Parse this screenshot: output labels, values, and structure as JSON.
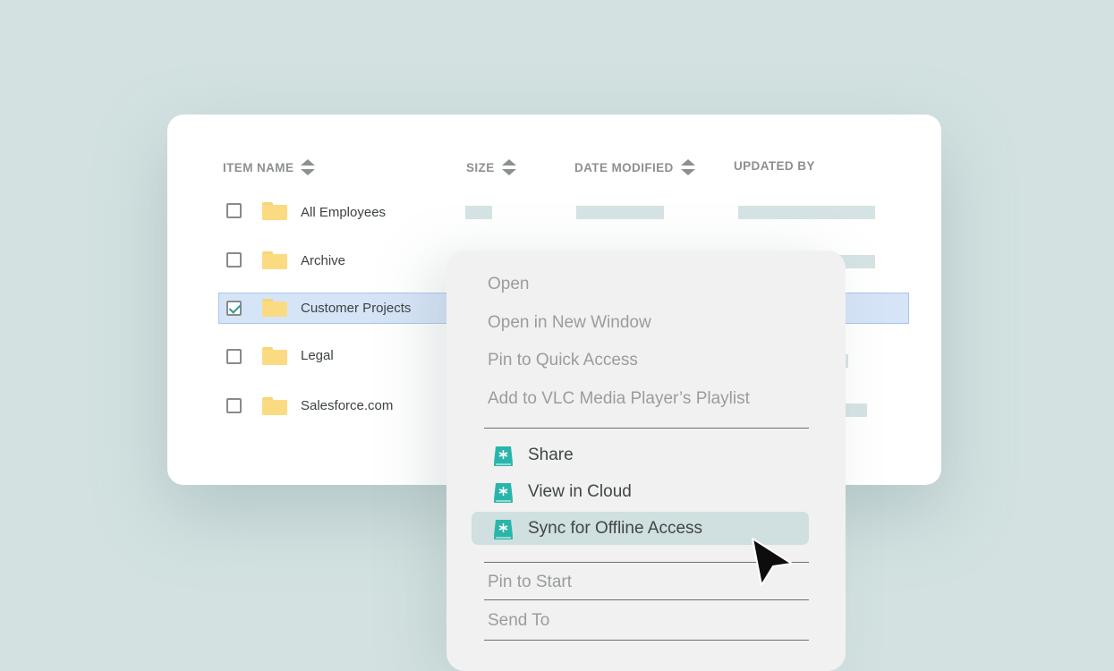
{
  "table": {
    "columns": [
      {
        "label": "ITEM NAME",
        "sortable": true
      },
      {
        "label": "SIZE",
        "sortable": true
      },
      {
        "label": "DATE MODIFIED",
        "sortable": true
      },
      {
        "label": "UPDATED BY",
        "sortable": false
      }
    ],
    "rows": [
      {
        "name": "All Employees",
        "checked": false
      },
      {
        "name": "Archive",
        "checked": false
      },
      {
        "name": "Customer Projects",
        "checked": true
      },
      {
        "name": "Legal",
        "checked": false
      },
      {
        "name": "Salesforce.com",
        "checked": false
      }
    ]
  },
  "context_menu": {
    "items": [
      {
        "label": "Open"
      },
      {
        "label": "Open in New Window"
      },
      {
        "label": "Pin to Quick Access"
      },
      {
        "label": "Add to VLC Media Player’s Playlist"
      },
      {
        "label": "Share",
        "icon": "cloud-sync-app-icon"
      },
      {
        "label": "View in Cloud",
        "icon": "cloud-sync-app-icon"
      },
      {
        "label": "Sync for Offline Access",
        "icon": "cloud-sync-app-icon",
        "highlighted": true
      },
      {
        "label": "Pin to Start"
      },
      {
        "label": "Send To"
      }
    ]
  },
  "colors": {
    "background": "#d3e1e1",
    "selection": "#d5e4f7",
    "accent": "#2ab5aa",
    "folder": "#fbdb82"
  }
}
